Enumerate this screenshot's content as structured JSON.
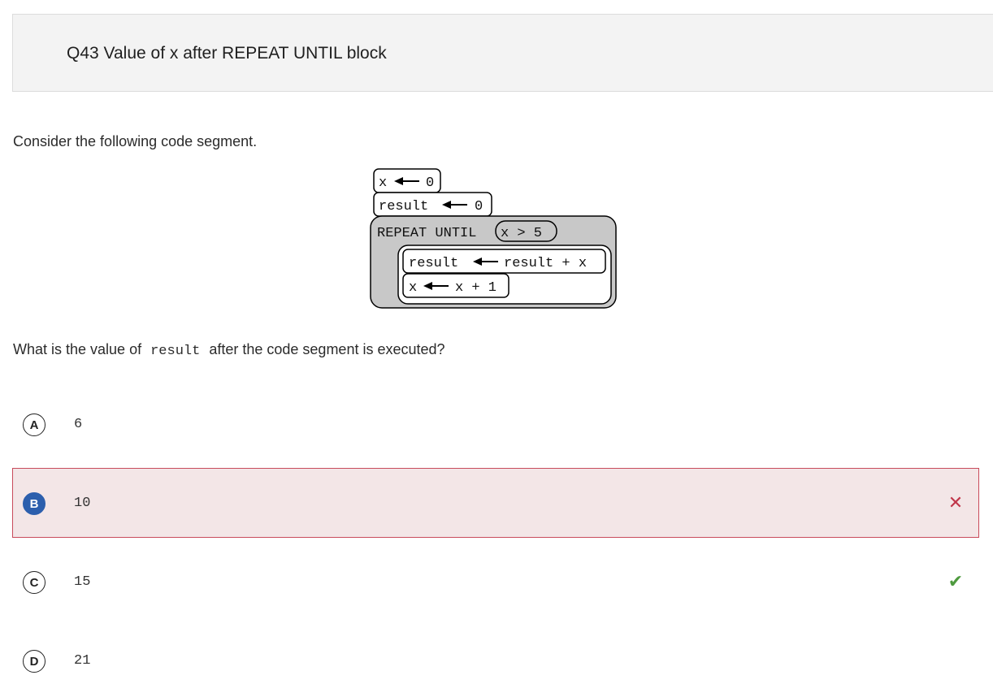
{
  "header": {
    "title": "Q43 Value of x after REPEAT UNTIL block"
  },
  "prompt": "Consider the following code segment.",
  "code_block": {
    "line1": {
      "var": "x",
      "arrow": "←",
      "value": "0"
    },
    "line2": {
      "var": "result",
      "arrow": "←",
      "value": "0"
    },
    "loop": {
      "keyword": "REPEAT UNTIL",
      "condition": "x > 5",
      "body": [
        {
          "var": "result",
          "arrow": "←",
          "expr": "result + x"
        },
        {
          "var": "x",
          "arrow": "←",
          "expr": "x + 1"
        }
      ]
    }
  },
  "question": {
    "before": "What is the value of",
    "code": "result",
    "after": "after the code segment is executed?"
  },
  "choices": [
    {
      "letter": "A",
      "value": "6",
      "state": "none"
    },
    {
      "letter": "B",
      "value": "10",
      "state": "selected-wrong"
    },
    {
      "letter": "C",
      "value": "15",
      "state": "correct"
    },
    {
      "letter": "D",
      "value": "21",
      "state": "none"
    }
  ],
  "colors": {
    "selected_bg": "#f3e6e7",
    "selected_border": "#c84b5b",
    "selected_badge": "#2c5fad",
    "wrong_mark": "#c0364a",
    "correct_mark": "#4e9a3e",
    "loop_fill": "#c8c8c8"
  },
  "icons": {
    "wrong": "x-mark-icon",
    "correct": "check-mark-icon"
  }
}
